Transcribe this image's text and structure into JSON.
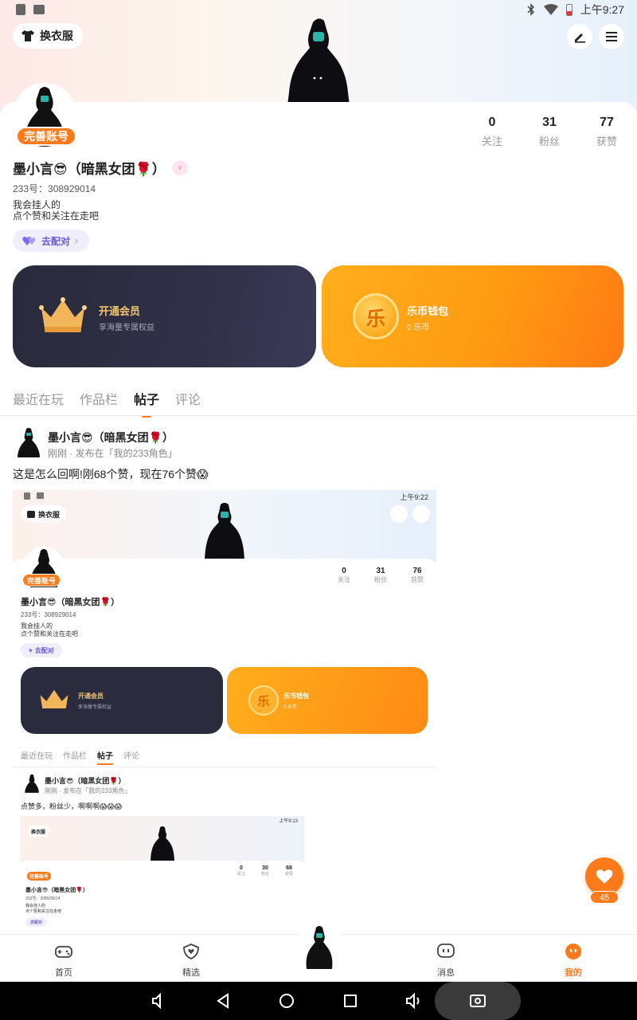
{
  "status_bar": {
    "time": "上午9:27"
  },
  "header": {
    "outfit_label": "换衣服"
  },
  "profile": {
    "complete_badge": "完善账号",
    "name": "墨小言😎（暗黑女团🌹）",
    "uid": "233号：308929014",
    "bio_line1": "我会挂人的",
    "bio_line2": "点个赞和关注在走吧",
    "pair_label": "去配对",
    "stats": [
      {
        "num": "0",
        "label": "关注"
      },
      {
        "num": "31",
        "label": "粉丝"
      },
      {
        "num": "77",
        "label": "获赞"
      }
    ]
  },
  "cards": {
    "vip_title": "开通会员",
    "vip_sub": "享海量专属权益",
    "coin_title": "乐币钱包",
    "coin_sub": "0 乐币",
    "coin_glyph": "乐"
  },
  "tabs": [
    "最近在玩",
    "作品栏",
    "帖子",
    "评论"
  ],
  "active_tab": "帖子",
  "post": {
    "author": "墨小言😎（暗黑女团🌹）",
    "meta": "刚刚 · 发布在「我的233角色」",
    "text": "这是怎么回啊!刚68个赞，现在76个赞😱",
    "screenshot": {
      "time": "上午9:22",
      "outfit_label": "换衣服",
      "stats": [
        {
          "num": "0",
          "label": "关注"
        },
        {
          "num": "31",
          "label": "粉丝"
        },
        {
          "num": "76",
          "label": "获赞"
        }
      ],
      "complete_badge": "完善账号",
      "name": "墨小言😎（暗黑女团🌹）",
      "uid": "233号：308929014",
      "bio_line1": "我会挂人的",
      "bio_line2": "点个赞和关注在走吧",
      "pair_label": "去配对",
      "vip_title": "开通会员",
      "vip_sub": "享海量专属权益",
      "coin_title": "乐币钱包",
      "coin_sub": "0 乐币",
      "tabs": [
        "最近在玩",
        "作品栏",
        "帖子",
        "评论"
      ],
      "post_author": "墨小言😎（暗黑女团🌹）",
      "post_meta": "刚刚 · 发布在「我的233角色」",
      "post_text": "点赞多，粉丝少，啊啊啊😱😱😱",
      "inner": {
        "time": "上午9:13",
        "outfit_label": "换衣服",
        "stats": [
          {
            "num": "0",
            "label": "关注"
          },
          {
            "num": "30",
            "label": "粉丝"
          },
          {
            "num": "68",
            "label": "获赞"
          }
        ],
        "complete_badge": "完善账号",
        "name": "墨小言😎（暗黑女团🌹）",
        "uid": "233号：308929014",
        "bio_line1": "我会挂人的",
        "bio_line2": "点个赞和关注在走吧",
        "pair_label": "去配对"
      }
    }
  },
  "like_count": "45",
  "bottom_nav": [
    {
      "label": "首页",
      "icon": "gamepad-icon"
    },
    {
      "label": "精选",
      "icon": "heart-shield-icon"
    },
    {
      "label": "消息",
      "icon": "chat-icon"
    },
    {
      "label": "我的",
      "icon": "profile-face-icon"
    }
  ],
  "colors": {
    "accent": "#ff7a1a",
    "vip_dark": "#2a2a3c",
    "coin_orange": "#ffa11a",
    "pair_purple": "#6b5ad6"
  }
}
